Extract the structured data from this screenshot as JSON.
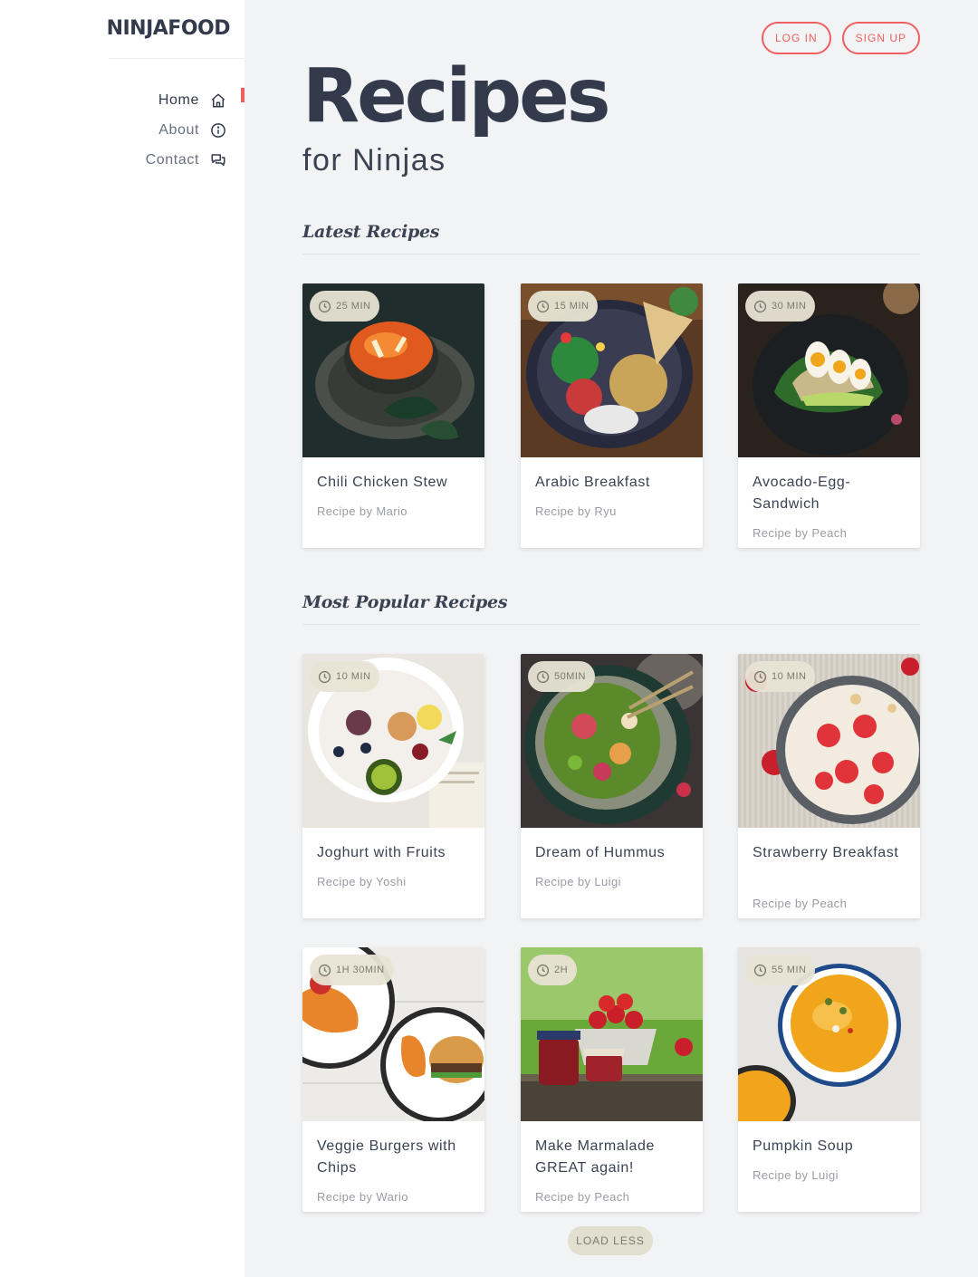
{
  "brand": {
    "logo": "NINJAFOOD"
  },
  "sidebar": {
    "items": [
      {
        "label": "Home",
        "icon": "home-icon",
        "active": true
      },
      {
        "label": "About",
        "icon": "info-icon",
        "active": false
      },
      {
        "label": "Contact",
        "icon": "chat-icon",
        "active": false
      }
    ]
  },
  "header": {
    "login_label": "LOG IN",
    "signup_label": "SIGN UP"
  },
  "hero": {
    "title": "Recipes",
    "subtitle": "for Ninjas"
  },
  "latest": {
    "title": "Latest Recipes",
    "cards": [
      {
        "time": "25 MIN",
        "title": "Chili Chicken Stew",
        "author": "Recipe by Mario",
        "image": "soup-bowl-image"
      },
      {
        "time": "15 MIN",
        "title": "Arabic Breakfast",
        "author": "Recipe by Ryu",
        "image": "salad-bowl-image"
      },
      {
        "time": "30 MIN",
        "title": "Avocado-Egg-Sandwich",
        "author": "Recipe by Peach",
        "image": "egg-avocado-image"
      }
    ]
  },
  "popular": {
    "title": "Most Popular Recipes",
    "cards": [
      {
        "time": "10 MIN",
        "title": "Joghurt with Fruits",
        "author": "Recipe by Yoshi",
        "image": "fruit-bowl-image"
      },
      {
        "time": "50MIN",
        "title": "Dream of Hummus",
        "author": "Recipe by Luigi",
        "image": "hummus-salad-image"
      },
      {
        "time": "10 MIN",
        "title": "Strawberry Breakfast",
        "author": "Recipe by Peach",
        "image": "strawberry-bowl-image"
      },
      {
        "time": "1H 30MIN",
        "title": "Veggie Burgers with Chips",
        "author": "Recipe by Wario",
        "image": "burger-plates-image"
      },
      {
        "time": "2H",
        "title": "Make Marmalade GREAT again!",
        "author": "Recipe by Peach",
        "image": "marmalade-jars-image"
      },
      {
        "time": "55 MIN",
        "title": "Pumpkin Soup",
        "author": "Recipe by Luigi",
        "image": "pumpkin-soup-image"
      }
    ]
  },
  "load_button": "LOAD LESS",
  "colors": {
    "accent": "#f15f5f",
    "text": "#323a4b",
    "muted": "#9a9ca5",
    "badge": "#e8e4d4",
    "background": "#f2f3f4"
  }
}
